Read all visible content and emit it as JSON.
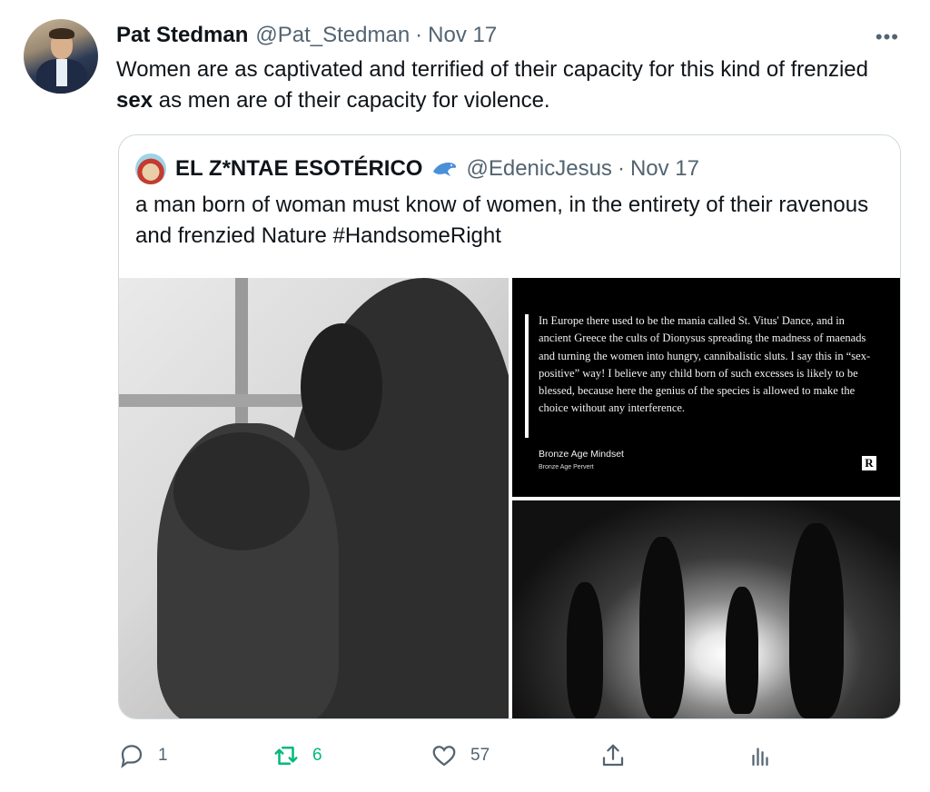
{
  "tweet": {
    "author_name": "Pat Stedman",
    "author_handle": "@Pat_Stedman",
    "separator": "·",
    "date": "Nov 17",
    "more_label": "•••",
    "text_part1": "Women are as captivated and terrified of their capacity for this kind of frenzied ",
    "text_bold": "sex",
    "text_part2": " as men are of their capacity for violence."
  },
  "quoted": {
    "author_name": "EL Z*NTAE ESOTÉRICO",
    "author_handle": "@EdenicJesus",
    "separator": "·",
    "date": "Nov 17",
    "text": "a man born of woman must know of women, in the entirety of their ravenous and frenzied Nature #HandsomeRight",
    "image_quote": {
      "text": "In Europe there used to be the mania called St. Vitus' Dance, and in ancient Greece the cults of Dionysus spreading the madness of maenads and turning the women into hungry, cannibalistic sluts. I say this in “sex-positive” way! I believe any child born of such excesses is likely to be blessed, because here the genius of the species is allowed to make the choice without any interference.",
      "author": "Bronze Age Mindset",
      "author_sub": "Bronze Age Pervert",
      "logo": "R"
    }
  },
  "actions": {
    "reply_count": "1",
    "retweet_count": "6",
    "like_count": "57"
  },
  "colors": {
    "text": "#0f1419",
    "secondary": "#536471",
    "retweet": "#00ba7c",
    "border": "#cfd9de"
  }
}
